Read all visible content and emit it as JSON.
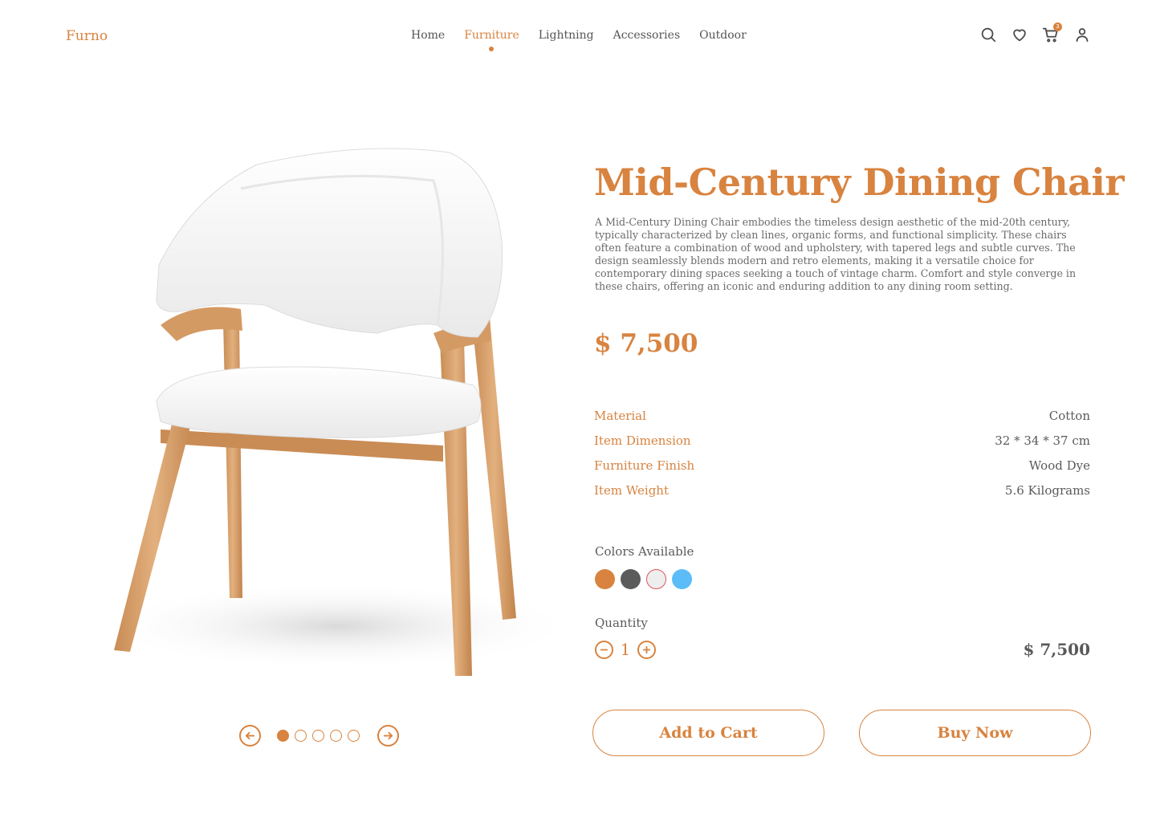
{
  "brand": {
    "name": "Furno",
    "accent": "#d8833f"
  },
  "nav": {
    "items": [
      {
        "label": "Home"
      },
      {
        "label": "Furniture",
        "active": true
      },
      {
        "label": "Lightning"
      },
      {
        "label": "Accessories"
      },
      {
        "label": "Outdoor"
      }
    ]
  },
  "header_icons": {
    "icons": [
      "search-icon",
      "heart-icon",
      "cart-icon",
      "user-icon"
    ],
    "cart_count": "3"
  },
  "product": {
    "title": "Mid-Century Dining Chair",
    "description": "A Mid-Century Dining Chair embodies the timeless design aesthetic of the mid-20th century, typically characterized by clean lines, organic forms, and functional simplicity. These chairs often feature a combination of wood and upholstery, with tapered legs and subtle curves. The design seamlessly blends modern and retro elements, making it a versatile choice for contemporary dining spaces seeking a touch of vintage charm. Comfort and style converge in these chairs, offering an iconic and enduring addition to any dining room setting.",
    "price": "$ 7,500",
    "specs": [
      {
        "label": "Material",
        "value": "Cotton"
      },
      {
        "label": "Item Dimension",
        "value": "32 * 34 * 37 cm"
      },
      {
        "label": "Furniture Finish",
        "value": "Wood Dye"
      },
      {
        "label": "Item Weight",
        "value": "5.6 Kilograms"
      }
    ],
    "colors_label": "Colors Available",
    "colors": [
      "#d8833f",
      "#5b5b5b",
      "#eeeeee",
      "#5bbcf7"
    ],
    "quantity_label": "Quantity",
    "quantity": "1",
    "line_total": "$ 7,500"
  },
  "carousel": {
    "count": 5,
    "active_index": 0
  },
  "actions": {
    "add_to_cart": "Add to Cart",
    "buy_now": "Buy Now"
  }
}
